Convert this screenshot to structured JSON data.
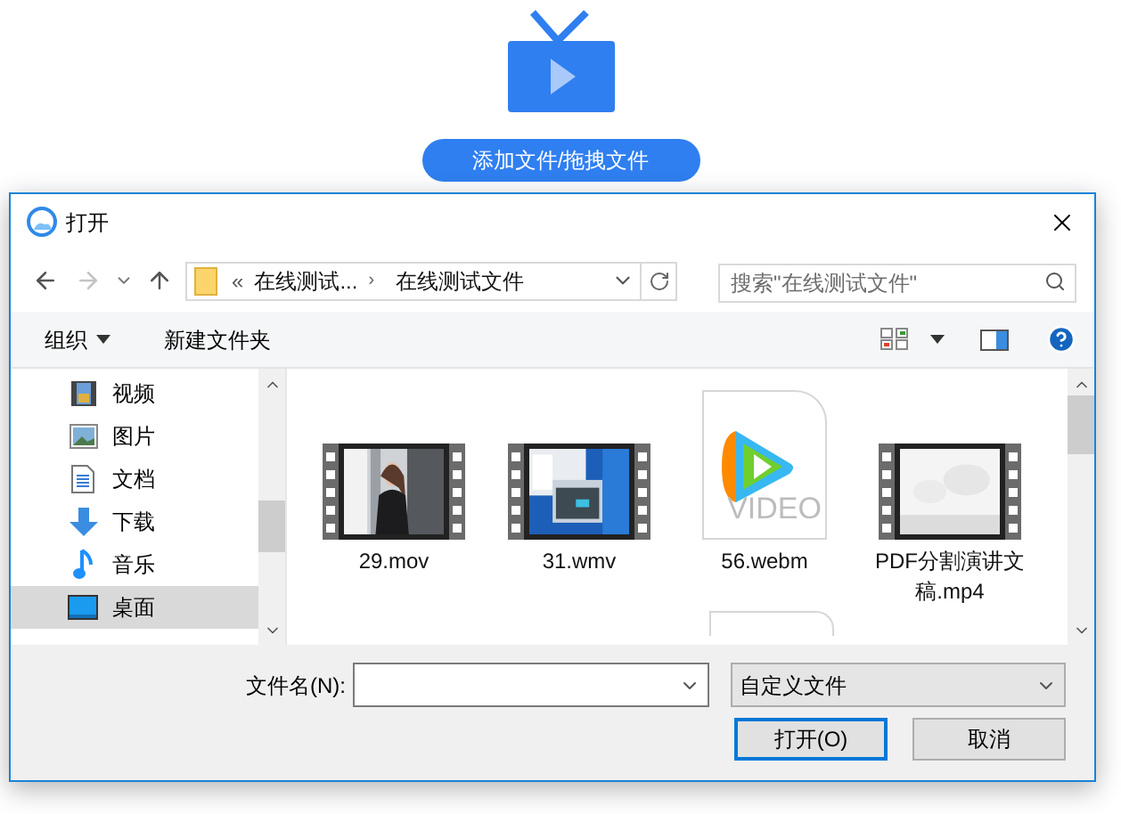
{
  "page": {
    "upload_button": "添加文件/拖拽文件"
  },
  "dialog": {
    "title": "打开",
    "address": {
      "overflow": "«",
      "separator": "›",
      "crumbs": [
        "在线测试...",
        "在线测试文件"
      ]
    },
    "search": {
      "placeholder": "搜索\"在线测试文件\""
    },
    "toolbar": {
      "organize": "组织",
      "new_folder": "新建文件夹"
    },
    "sidebar": {
      "items": [
        {
          "label": "视频",
          "kind": "video",
          "selected": false
        },
        {
          "label": "图片",
          "kind": "pictures",
          "selected": false
        },
        {
          "label": "文档",
          "kind": "documents",
          "selected": false
        },
        {
          "label": "下载",
          "kind": "downloads",
          "selected": false
        },
        {
          "label": "音乐",
          "kind": "music",
          "selected": false
        },
        {
          "label": "桌面",
          "kind": "desktop",
          "selected": true
        }
      ]
    },
    "files": [
      {
        "name": "29.mov",
        "kind": "video"
      },
      {
        "name": "31.wmv",
        "kind": "video"
      },
      {
        "name": "56.webm",
        "kind": "app",
        "badge": "VIDEO"
      },
      {
        "name": "PDF分割演讲文稿.mp4",
        "kind": "video"
      },
      {
        "kind": "document"
      }
    ],
    "filename": {
      "label": "文件名(N):"
    },
    "filter": {
      "value": "自定义文件"
    },
    "buttons": [
      {
        "label": "打开(O)",
        "default": true
      },
      {
        "label": "取消",
        "default": false
      }
    ]
  }
}
